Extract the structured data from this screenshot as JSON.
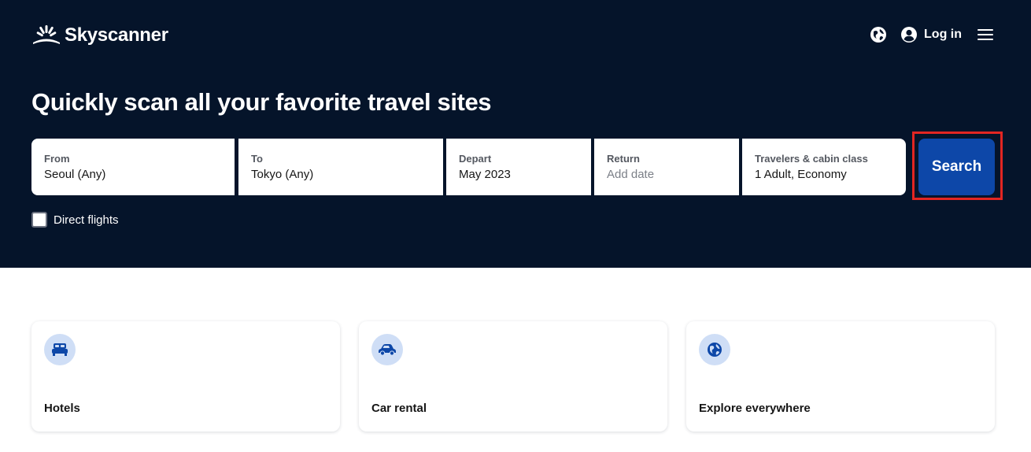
{
  "header": {
    "brand": "Skyscanner",
    "login_label": "Log in",
    "icons": {
      "region": "globe-icon",
      "account": "user-circle-icon",
      "menu": "hamburger-menu-icon"
    }
  },
  "hero": {
    "headline": "Quickly scan all your favorite travel sites"
  },
  "search_form": {
    "from": {
      "label": "From",
      "value": "Seoul (Any)"
    },
    "to": {
      "label": "To",
      "value": "Tokyo (Any)"
    },
    "depart": {
      "label": "Depart",
      "value": "May 2023"
    },
    "return": {
      "label": "Return",
      "placeholder": "Add date"
    },
    "travelers": {
      "label": "Travelers & cabin class",
      "value": "1 Adult, Economy"
    },
    "search_label": "Search",
    "direct_flights_label": "Direct flights",
    "direct_flights_checked": false
  },
  "cards": [
    {
      "label": "Hotels",
      "icon": "bed-icon"
    },
    {
      "label": "Car rental",
      "icon": "car-icon"
    },
    {
      "label": "Explore everywhere",
      "icon": "globe-icon"
    }
  ],
  "colors": {
    "hero_bg": "#05142a",
    "search_button": "#0d47a8",
    "highlight_outline": "#e32622",
    "card_icon_bg": "#cfdef6"
  }
}
